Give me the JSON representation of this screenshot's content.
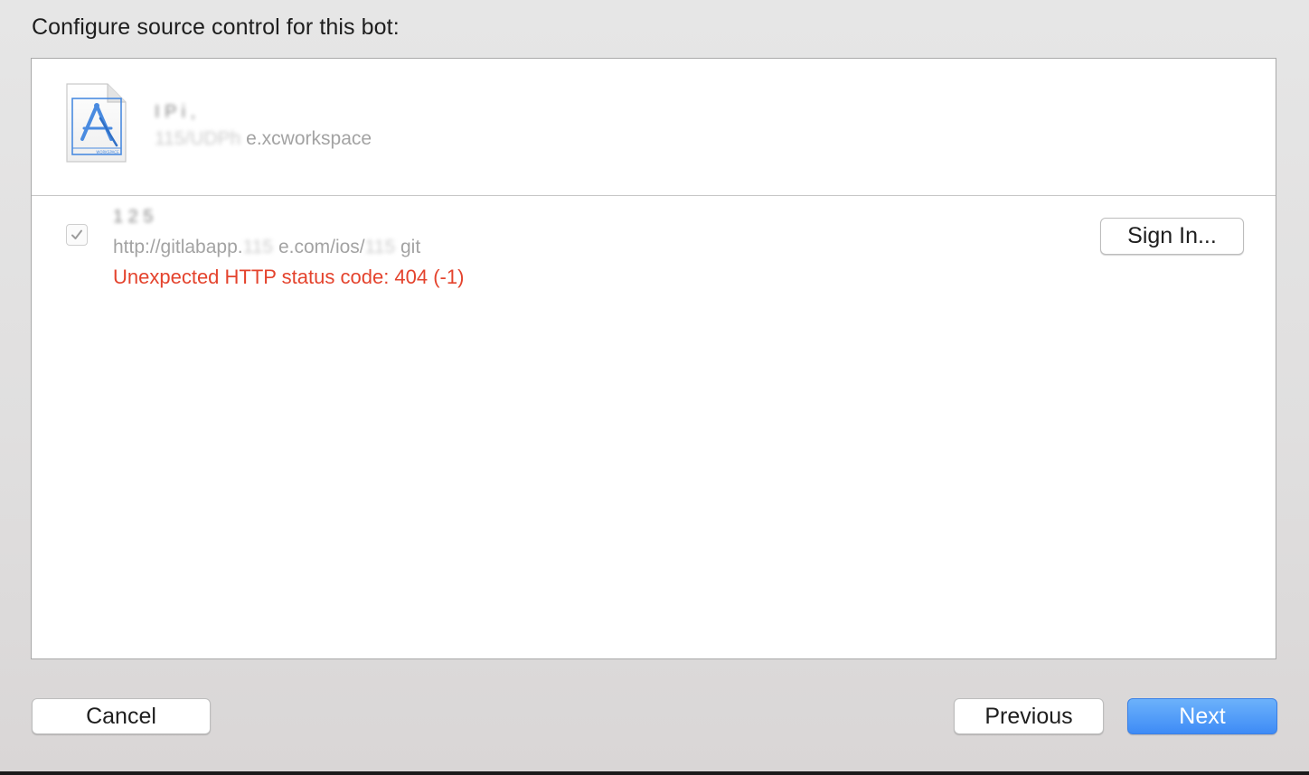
{
  "heading": "Configure source control for this bot:",
  "workspace": {
    "name": "I  P  i        ,",
    "path_masked": "115/UDPh   ",
    "path_suffix": "e.xcworkspace",
    "icon": "xcode-workspace-icon",
    "icon_label": "WORKSPACE"
  },
  "repository": {
    "checked": true,
    "name": "1 2 5",
    "url_prefix": "http://gitlabapp.",
    "url_masked_1": "115   ",
    "url_middle": "e.com/ios/",
    "url_masked_2": "115  ",
    "url_suffix": "git",
    "error": "Unexpected HTTP status code: 404 (-1)",
    "error_color": "#e4432d",
    "sign_in_label": "Sign In..."
  },
  "footer": {
    "cancel_label": "Cancel",
    "previous_label": "Previous",
    "next_label": "Next",
    "accent": "#3e8bf6"
  }
}
